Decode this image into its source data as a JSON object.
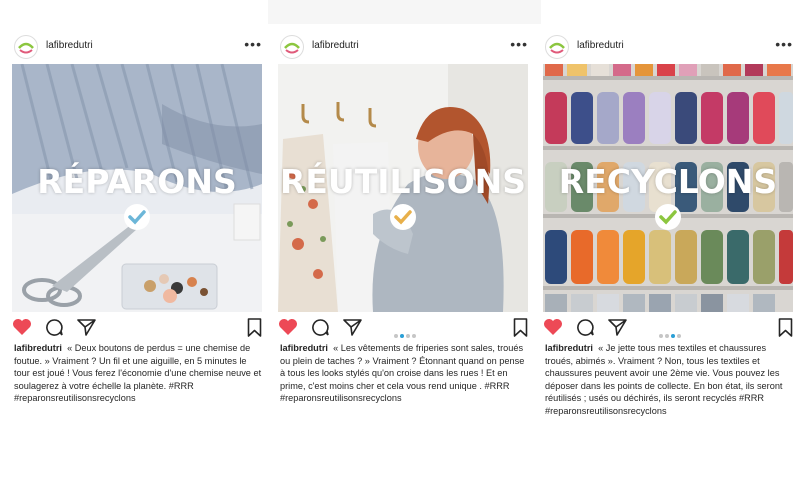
{
  "posts": [
    {
      "username": "lafibredutri",
      "word": "RÉPARONS",
      "check_color": "#6cb6d8",
      "caption_user": "lafibredutri",
      "caption": "« Deux boutons de perdus = une chemise de foutue. » Vraiment ? Un fil et une aiguille, en 5 minutes le tour est joué ! Vous ferez l'économie d'une chemise neuve et soulagerez à votre échelle la planète. #RRR #reparonsreutilisonsrecyclons",
      "carousel": null
    },
    {
      "username": "lafibredutri",
      "word": "RÉUTILISONS",
      "check_color": "#e8b04a",
      "caption_user": "lafibredutri",
      "caption": "« Les vêtements de friperies sont sales, troués ou plein de taches ? » Vraiment ? Étonnant quand on pense à tous les looks stylés qu'on croise dans les rues ! Et en prime, c'est moins cher et cela vous rend unique . #RRR #reparonsreutilisonsrecyclons",
      "carousel": {
        "count": 4,
        "active": 1
      }
    },
    {
      "username": "lafibredutri",
      "word": "RECYCLONS",
      "check_color": "#8cc63f",
      "caption_user": "lafibredutri",
      "caption": "« Je jette tous mes textiles et chaussures troués, abimés ». Vraiment ? Non, tous les textiles et chaussures peuvent avoir une 2ème vie. Vous pouvez les déposer dans les points de collecte. En bon état, ils seront réutilisés ; usés ou déchirés, ils seront recyclés #RRR #reparonsreutilisonsrecyclons",
      "carousel": {
        "count": 4,
        "active": 2
      }
    }
  ],
  "colors": {
    "heart": "#ed4956",
    "carousel_active": "#2a9fd6"
  },
  "icons": [
    "heart-icon",
    "comment-icon",
    "share-icon",
    "bookmark-icon",
    "more-icon",
    "check-icon"
  ]
}
